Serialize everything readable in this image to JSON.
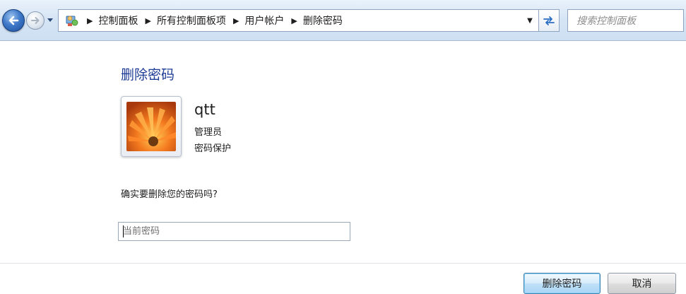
{
  "nav": {
    "breadcrumbs": [
      "控制面板",
      "所有控制面板项",
      "用户帐户",
      "删除密码"
    ],
    "separator": "▶",
    "dropdown_glyph": "▼",
    "search_placeholder": "搜索控制面板",
    "icons": {
      "back": "back-arrow-icon",
      "forward": "forward-arrow-icon",
      "history": "history-dropdown-icon",
      "control_panel": "control-panel-icon",
      "refresh": "refresh-icon"
    }
  },
  "page": {
    "title": "删除密码",
    "title_color": "#1e3c96"
  },
  "user": {
    "name": "qtt",
    "role": "管理员",
    "status": "密码保护",
    "picture_icon": "flower-avatar"
  },
  "confirm": {
    "question": "确实要删除您的密码吗?"
  },
  "password_field": {
    "placeholder": "当前密码",
    "value": ""
  },
  "buttons": {
    "delete_label": "删除密码",
    "cancel_label": "取消"
  }
}
